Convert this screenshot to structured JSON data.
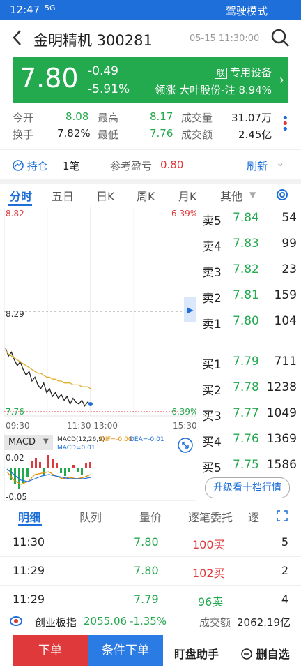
{
  "status": {
    "time": "12:47",
    "signal": "5G",
    "mode": "驾驶模式"
  },
  "stock": {
    "name_code": "金明精机 300281",
    "datetime": "05-15 11:30:00",
    "price": "7.80",
    "change": "-0.49",
    "change_pct": "-5.91%",
    "sector_tag": "联",
    "sector": "专用设备",
    "lead_prefix": "领涨",
    "lead": "大叶股份-注 8.94%",
    "stats": {
      "open_label": "今开",
      "open": "8.08",
      "high_label": "最高",
      "high": "8.17",
      "vol_label": "成交量",
      "vol": "31.07万",
      "turn_label": "换手",
      "turn": "7.82%",
      "low_label": "最低",
      "low": "7.76",
      "amt_label": "成交额",
      "amt": "2.45亿"
    }
  },
  "holding": {
    "label": "持仓",
    "count": "1笔",
    "pl_label": "参考盈亏",
    "pl": "0.80",
    "refresh": "刷新"
  },
  "tabs": [
    "分时",
    "五日",
    "日K",
    "周K",
    "月K",
    "其他"
  ],
  "chart": {
    "top_left": "8.82",
    "top_right": "6.39%",
    "mid": "8.29",
    "bot_left": "7.76",
    "bot_right": "-6.39%",
    "x_start": "09:30",
    "x_mid": "11:30 13:00",
    "x_end": "15:30"
  },
  "chart_data": {
    "type": "line",
    "ylim": [
      7.76,
      8.82
    ],
    "series": [
      {
        "values": [
          8.09,
          8.05,
          8.07,
          8.03,
          8.0,
          8.02,
          7.98,
          7.95,
          7.97,
          7.92,
          7.94,
          7.9,
          7.88,
          7.91,
          7.86,
          7.88,
          7.84,
          7.86,
          7.83,
          7.85,
          7.82,
          7.84,
          7.8,
          7.83,
          7.81,
          7.8,
          7.82,
          7.79,
          7.81,
          7.8
        ]
      },
      {
        "values": [
          8.08,
          8.06,
          8.05,
          8.04,
          8.03,
          8.02,
          8.01,
          8.0,
          7.99,
          7.98,
          7.97,
          7.96,
          7.96,
          7.95,
          7.94,
          7.94,
          7.93,
          7.93,
          7.92,
          7.92,
          7.91,
          7.91,
          7.91,
          7.9,
          7.9,
          7.9,
          7.89,
          7.89,
          7.89,
          7.88
        ]
      }
    ]
  },
  "macd": {
    "btn": "MACD",
    "params": "MACD(12,26,9)",
    "dif": "DIF=-0.00",
    "dea": "DEA=-0.01",
    "macd": "MACD=0.01",
    "top": "0.02",
    "bot": "-0.05"
  },
  "orderbook": [
    {
      "k": "卖5",
      "p": "7.84",
      "v": "54"
    },
    {
      "k": "卖4",
      "p": "7.83",
      "v": "99"
    },
    {
      "k": "卖3",
      "p": "7.82",
      "v": "23"
    },
    {
      "k": "卖2",
      "p": "7.81",
      "v": "159"
    },
    {
      "k": "卖1",
      "p": "7.80",
      "v": "104"
    },
    {
      "k": "买1",
      "p": "7.79",
      "v": "711"
    },
    {
      "k": "买2",
      "p": "7.78",
      "v": "1238"
    },
    {
      "k": "买3",
      "p": "7.77",
      "v": "1049"
    },
    {
      "k": "买4",
      "p": "7.76",
      "v": "1369"
    },
    {
      "k": "买5",
      "p": "7.75",
      "v": "1586"
    }
  ],
  "upgrade": "升级看十档行情",
  "detail_tabs": [
    "明细",
    "队列",
    "量价",
    "逐笔委托",
    "逐"
  ],
  "trades": [
    {
      "t": "11:30",
      "p": "7.80",
      "q": "100买",
      "n": "5"
    },
    {
      "t": "11:29",
      "p": "7.80",
      "q": "102买",
      "n": "2"
    },
    {
      "t": "11:29",
      "p": "7.79",
      "q": "96卖",
      "n": "4"
    }
  ],
  "index": {
    "name": "创业板指",
    "value": "2055.06",
    "chg": "-1.35%",
    "amt_label": "成交额",
    "amt": "2062.19亿"
  },
  "actions": {
    "order": "下单",
    "cond": "条件下单",
    "helper": "盯盘助手",
    "remove": "删自选"
  }
}
